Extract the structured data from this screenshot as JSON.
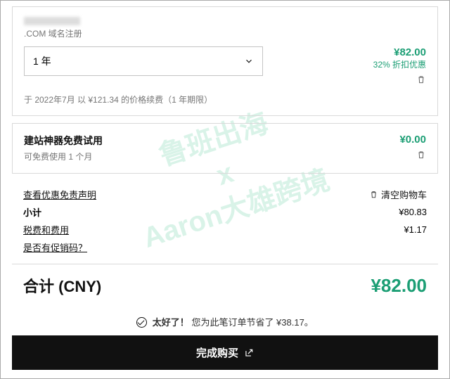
{
  "watermark": "鲁班出海\nx\nAaron大雄跨境",
  "item1": {
    "sub": ".COM 域名注册",
    "term": "1 年",
    "price": "¥82.00",
    "discount": "32% 折扣优惠",
    "renew": "于 2022年7月 以 ¥121.34 的价格续费（1 年期限）"
  },
  "item2": {
    "title": "建站神器免费试用",
    "sub": "可免费使用 1 个月",
    "price": "¥0.00"
  },
  "summary": {
    "disclaimer": "查看优惠免责声明",
    "clear": "清空购物车",
    "subtotal_l": "小计",
    "subtotal_v": "¥80.83",
    "tax_l": "税费和费用",
    "tax_v": "¥1.17",
    "promo": "是否有促销码？"
  },
  "total": {
    "label": "合计 (CNY)",
    "value": "¥82.00"
  },
  "savings": {
    "bold": "太好了！",
    "text": "您为此笔订单节省了 ¥38.17。"
  },
  "cta": "完成购买"
}
